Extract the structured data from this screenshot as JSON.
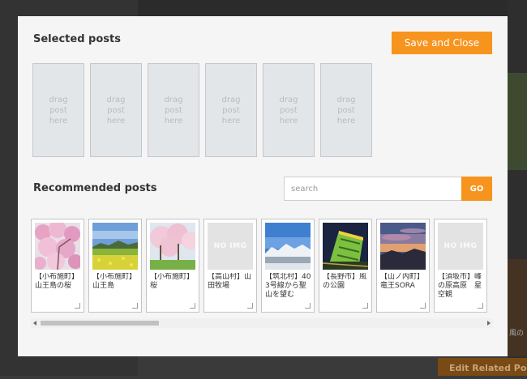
{
  "background": {
    "caption": "風の",
    "edit_related_button": "Edit Related Pos"
  },
  "modal": {
    "selected_title": "Selected posts",
    "save_button": "Save and Close",
    "drop_slot_text": "drag post here",
    "slot_count": 6,
    "recommended_title": "Recommended posts",
    "search_placeholder": "search",
    "search_value": "",
    "go_button": "GO",
    "noimg_label": "NO IMG",
    "scroll_position": 0.0,
    "cards": [
      {
        "title": "【小布施町】山王島の桜",
        "thumb": "cherry-blossom-pink"
      },
      {
        "title": "【小布施町】山王島",
        "thumb": "rapeseed-field"
      },
      {
        "title": "【小布施町】桜",
        "thumb": "cherry-blossom-trees"
      },
      {
        "title": "【高山村】山田牧場",
        "thumb": "noimg"
      },
      {
        "title": "【筑北村】403号線から聖山を望む",
        "thumb": "snowy-mountains"
      },
      {
        "title": "【長野市】風の公園",
        "thumb": "green-building"
      },
      {
        "title": "【山ノ内町】竜王SORA",
        "thumb": "sunset-sky"
      },
      {
        "title": "【須坂市】峰の原高原　星空観",
        "thumb": "noimg"
      }
    ]
  },
  "colors": {
    "accent": "#f7941d",
    "modal_bg": "#f5f5f5",
    "slot_bg": "#e3e6e8"
  }
}
